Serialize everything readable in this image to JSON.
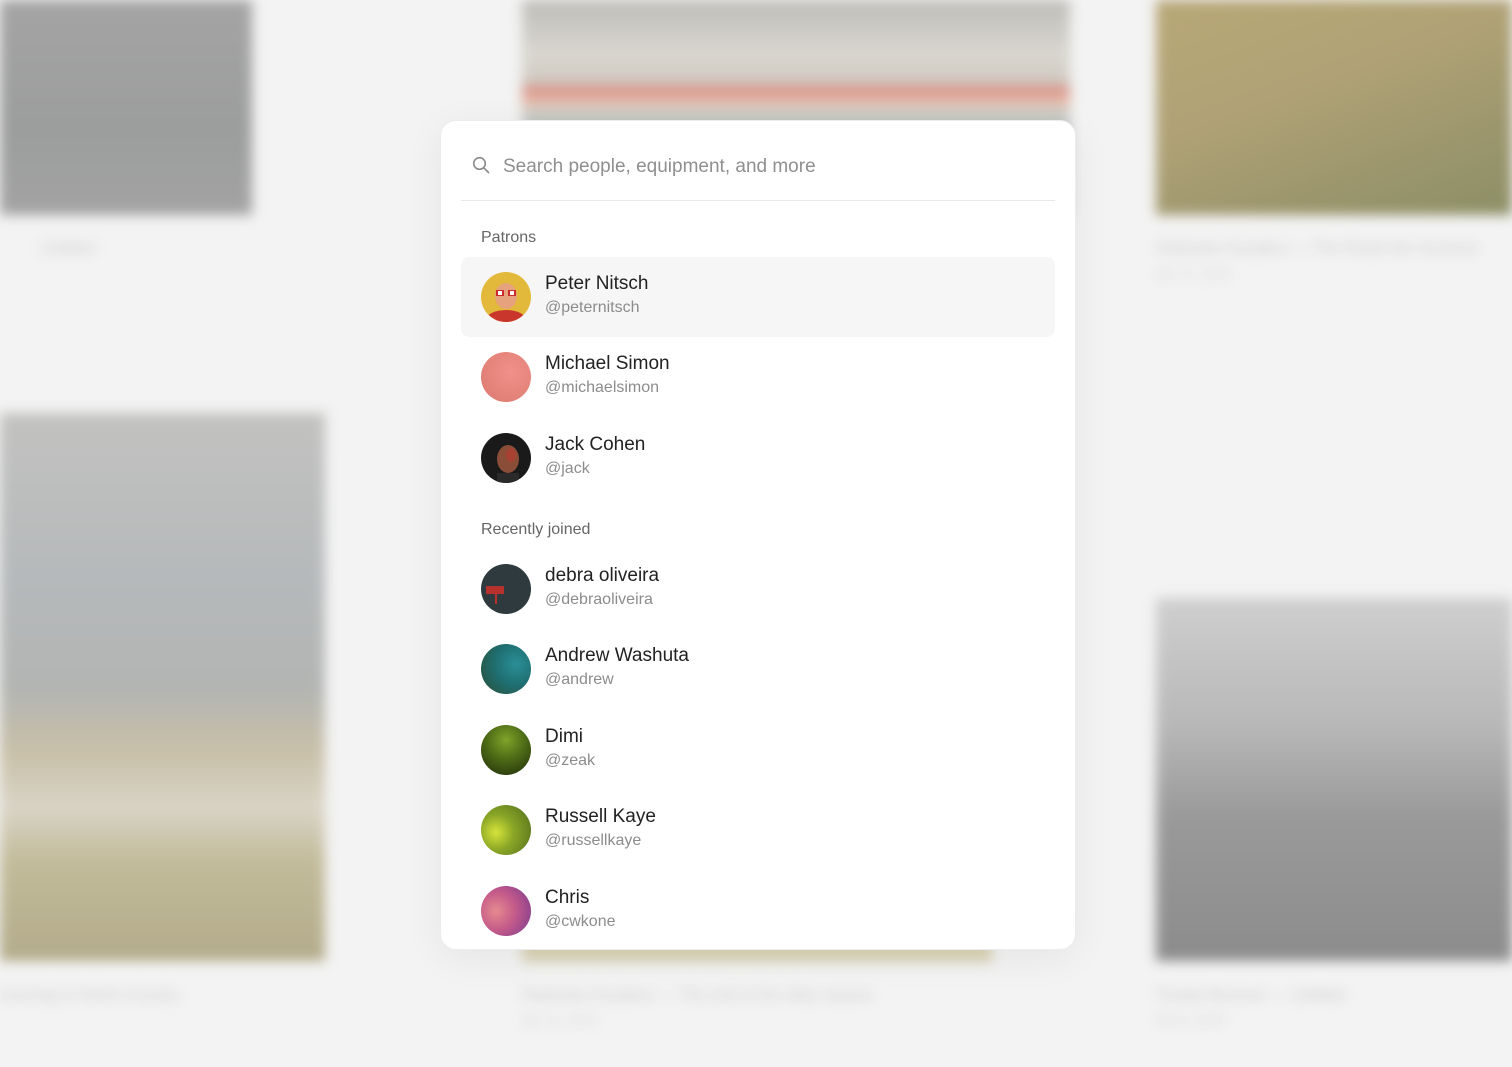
{
  "search": {
    "placeholder": "Search people, equipment, and more"
  },
  "sections": {
    "patrons": {
      "title": "Patrons",
      "items": [
        {
          "name": "Peter Nitsch",
          "handle": "@peternitsch"
        },
        {
          "name": "Michael Simon",
          "handle": "@michaelsimon"
        },
        {
          "name": "Jack Cohen",
          "handle": "@jack"
        }
      ]
    },
    "recent": {
      "title": "Recently joined",
      "items": [
        {
          "name": "debra oliveira",
          "handle": "@debraoliveira"
        },
        {
          "name": "Andrew Washuta",
          "handle": "@andrew"
        },
        {
          "name": "Dimi",
          "handle": "@zeak"
        },
        {
          "name": "Russell Kaye",
          "handle": "@russellkaye"
        },
        {
          "name": "Chris",
          "handle": "@cwkone"
        }
      ]
    }
  },
  "background": {
    "captions": [
      {
        "title": "Untitled",
        "date": ""
      },
      {
        "title": "Radoslav Kazakov — The Road Into Summer",
        "date": "Apr 12, 2023"
      },
      {
        "title": "morning in North Country",
        "date": ""
      },
      {
        "title": "Radoslav Kazakov — The end of the dirty season",
        "date": "Apr 12, 2023"
      },
      {
        "title": "Tondar Brenner — Untitled",
        "date": "Mar 8, 2023"
      }
    ]
  },
  "colors": {
    "selected_row": "#f6f6f6",
    "name_text": "#222222",
    "handle_text": "#8c8c8c"
  }
}
